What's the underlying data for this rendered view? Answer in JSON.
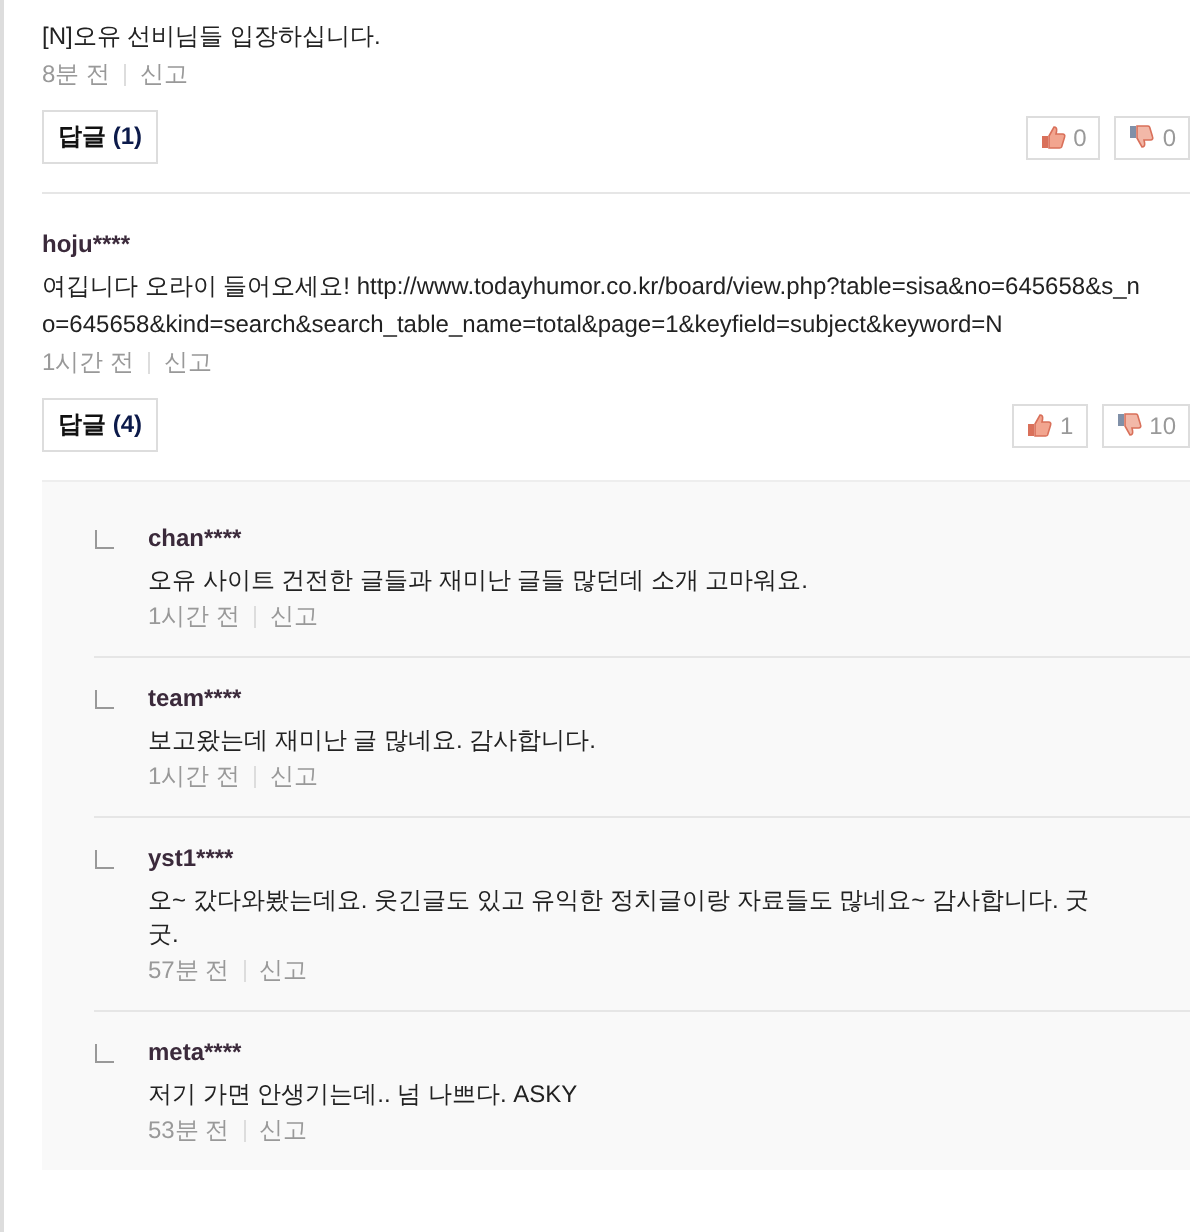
{
  "comments": [
    {
      "text": "[N]오유 선비님들 입장하십니다.",
      "time": "8분 전",
      "report": "신고",
      "reply_button": {
        "label": "답글",
        "count": "(1)"
      },
      "likes": "0",
      "dislikes": "0"
    },
    {
      "author": "hoju****",
      "text": "여깁니다 오라이 들어오세요! http://www.todayhumor.co.kr/board/view.php?table=sisa&no=645658&s_no=645658&kind=search&search_table_name=total&page=1&keyfield=subject&keyword=N",
      "time": "1시간 전",
      "report": "신고",
      "reply_button": {
        "label": "답글",
        "count": "(4)"
      },
      "likes": "1",
      "dislikes": "10",
      "replies": [
        {
          "author": "chan****",
          "text": "오유 사이트 건전한 글들과 재미난 글들 많던데 소개 고마워요.",
          "time": "1시간 전",
          "report": "신고"
        },
        {
          "author": "team****",
          "text": "보고왔는데 재미난 글 많네요. 감사합니다.",
          "time": "1시간 전",
          "report": "신고"
        },
        {
          "author": "yst1****",
          "text": "오~ 갔다와봤는데요. 웃긴글도 있고 유익한 정치글이랑 자료들도 많네요~ 감사합니다. 굿굿.",
          "time": "57분 전",
          "report": "신고"
        },
        {
          "author": "meta****",
          "text": "저기 가면 안생기는데.. 넘 나쁘다. ASKY",
          "time": "53분 전",
          "report": "신고"
        }
      ]
    }
  ]
}
